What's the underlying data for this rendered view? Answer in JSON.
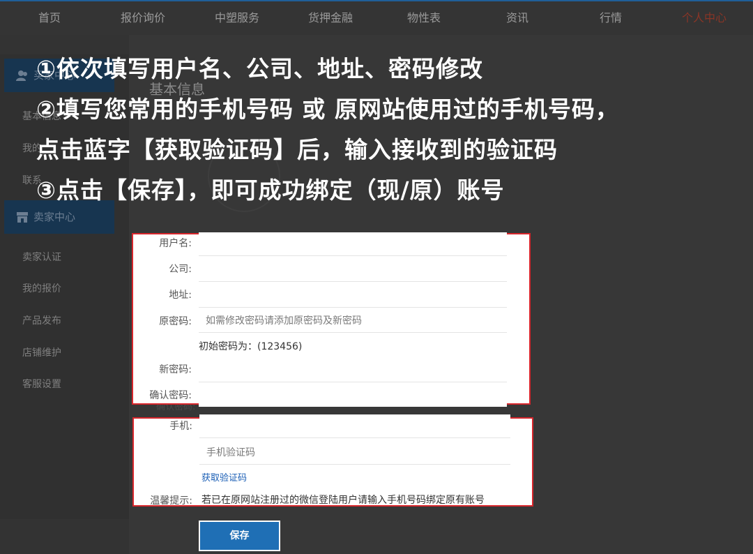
{
  "nav": {
    "items": [
      {
        "label": "首页"
      },
      {
        "label": "报价询价"
      },
      {
        "label": "中塑服务"
      },
      {
        "label": "货押金融"
      },
      {
        "label": "物性表"
      },
      {
        "label": "资讯"
      },
      {
        "label": "行情"
      },
      {
        "label": "个人中心"
      }
    ],
    "active_color": "#8a3526"
  },
  "sidebar": {
    "buyer_header": "买家中心",
    "buyer_links": [
      "基本信息",
      "我的",
      "联系"
    ],
    "seller_header": "卖家中心",
    "seller_links": [
      "卖家认证",
      "我的报价",
      "产品发布",
      "店铺维护",
      "客服设置"
    ]
  },
  "content": {
    "title": "基本信息"
  },
  "instructions": {
    "line1": "①依次填写用户名、公司、地址、密码修改",
    "line2": "②填写您常用的手机号码 或 原网站使用过的手机号码，",
    "line3": "点击蓝字【获取验证码】后，输入接收到的验证码",
    "line4": "③点击【保存】，即可成功绑定（现/原）账号"
  },
  "form": {
    "username_label": "用户名:",
    "username_value": "",
    "company_label": "公司:",
    "company_value": "",
    "address_label": "地址:",
    "address_value": "",
    "old_password_label": "原密码:",
    "old_password_placeholder": "如需修改密码请添加原密码及新密码",
    "initial_password_hint": "初始密码为：(123456)",
    "new_password_label": "新密码:",
    "confirm_password_label": "确认密码:",
    "confirm_password_underlay": "确认密码:",
    "phone_label": "手机:",
    "phone_value": "",
    "sms_code_placeholder": "手机验证码",
    "get_code_link": "获取验证码",
    "tip_label": "温馨提示:",
    "tip_text": "若已在原网站注册过的微信登陆用户请输入手机号码绑定原有账号",
    "save_button": "保存"
  },
  "colors": {
    "highlight_border": "#d8262c",
    "primary_button": "#1f6fb5",
    "link": "#1a5eb5",
    "sidebar_header": "#173550"
  }
}
